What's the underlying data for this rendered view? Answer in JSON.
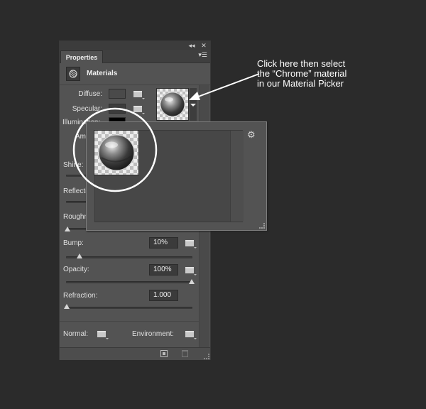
{
  "panel": {
    "tab_label": "Properties",
    "collapse_glyph": "◂◂",
    "close_glyph": "✕",
    "menu_glyph": "▾☰",
    "section_title": "Materials",
    "labels": {
      "diffuse": "Diffuse:",
      "specular": "Specular:",
      "illumination": "Illumination:",
      "ambient": "Ambient:",
      "shine": "Shine:",
      "reflection": "Reflection:",
      "roughness": "Roughness:",
      "bump": "Bump:",
      "opacity": "Opacity:",
      "refraction": "Refraction:",
      "normal": "Normal:",
      "environment": "Environment:"
    },
    "values": {
      "bump": "10%",
      "opacity": "100%",
      "refraction": "1.000"
    },
    "slider_levels": {
      "roughness": 0,
      "bump": 0.1,
      "opacity": 1.0,
      "refraction": 0
    },
    "colors": {
      "diffuse": "#4a4a4a",
      "specular": "#3c3c3c",
      "illumination": "#000000"
    }
  },
  "annotation": {
    "line1": "Click here then select",
    "line2": "the “Chrome” material",
    "line3": "in our Material Picker"
  },
  "picker": {
    "gear_glyph": "⚙",
    "selected_material_icon": "chrome-sphere-icon"
  },
  "accent": "#ffffff"
}
